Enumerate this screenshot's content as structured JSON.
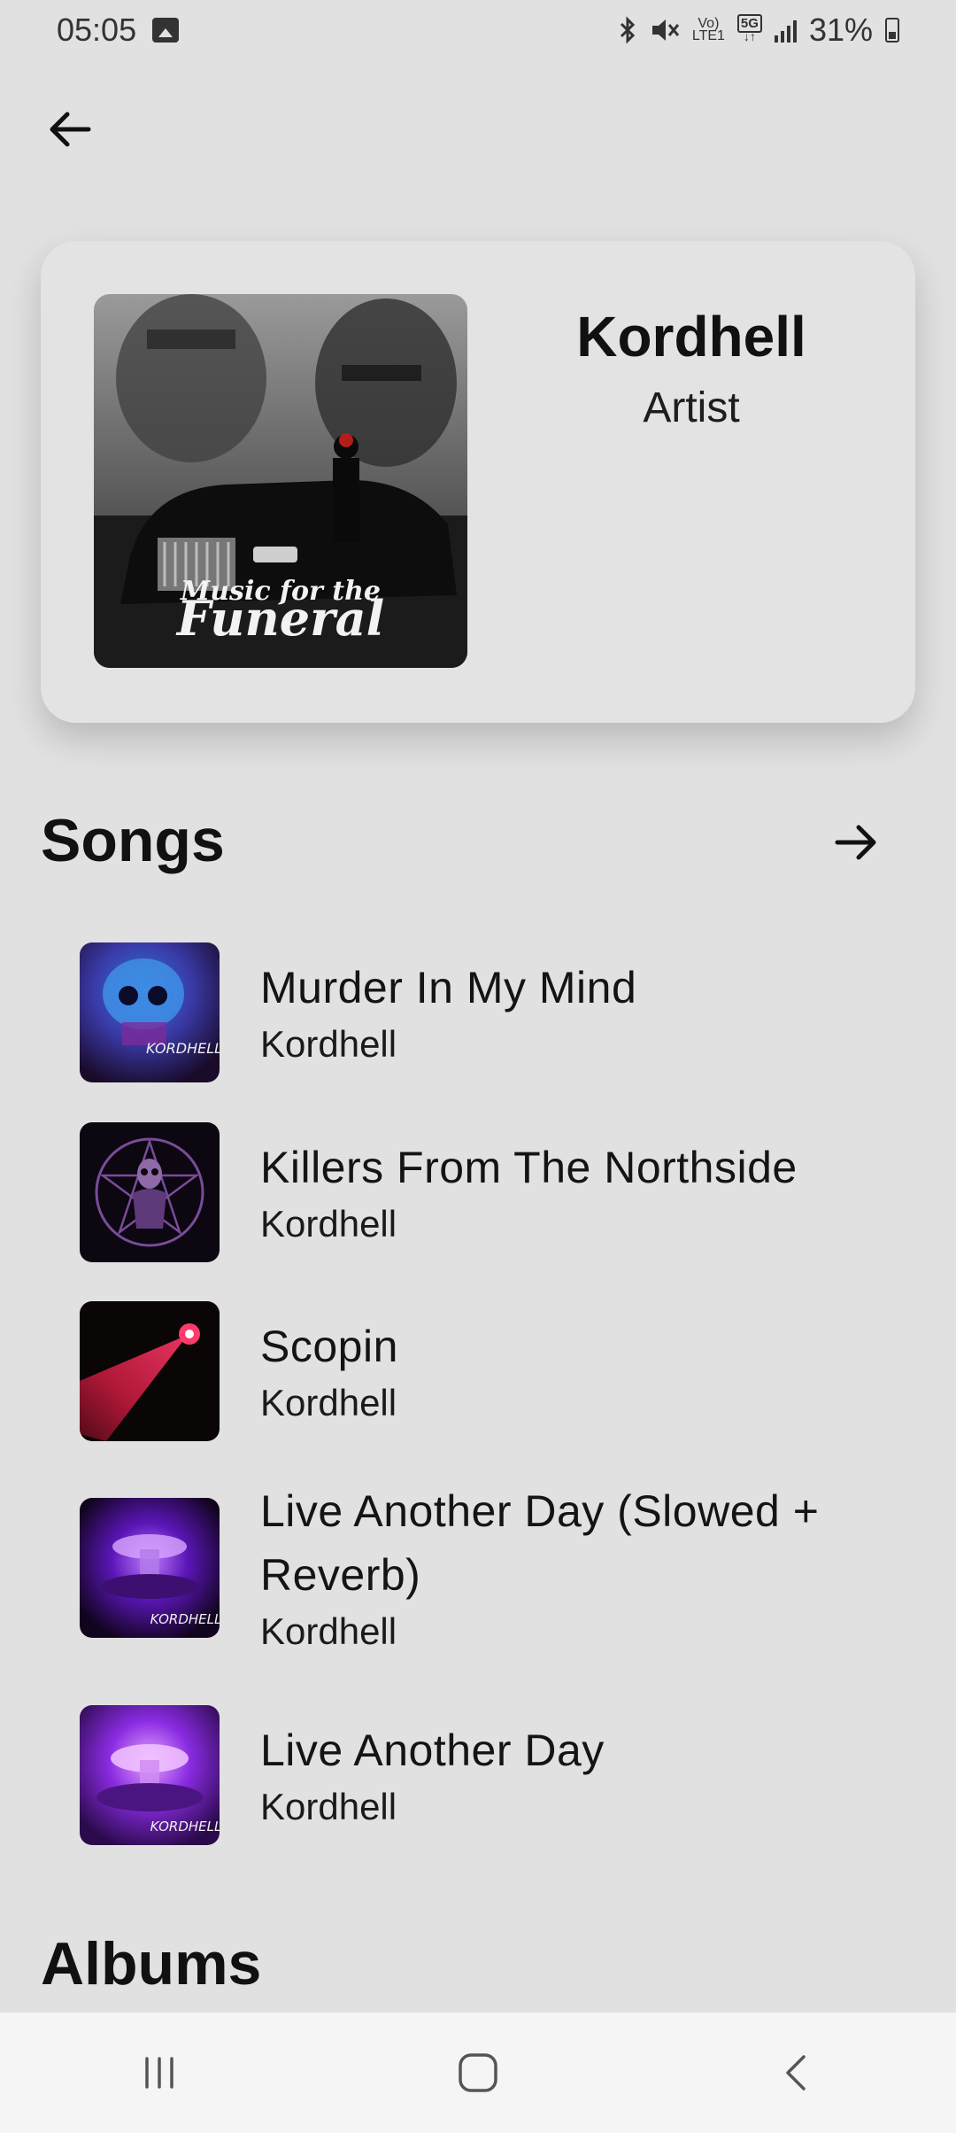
{
  "status_bar": {
    "time": "05:05",
    "network": "5G",
    "volte": "Vo)",
    "lte": "LTE1",
    "battery": "31%"
  },
  "artist": {
    "name": "Kordhell",
    "role": "Artist",
    "cover_text": "Music for the Funeral"
  },
  "sections": {
    "songs_title": "Songs",
    "albums_title": "Albums"
  },
  "songs": [
    {
      "title": "Murder In My Mind",
      "artist": "Kordhell",
      "art_label": "KORDHELL"
    },
    {
      "title": "Killers From The Northside",
      "artist": "Kordhell"
    },
    {
      "title": "Scopin",
      "artist": "Kordhell"
    },
    {
      "title": "Live Another Day (Slowed + Reverb)",
      "artist": "Kordhell",
      "art_label": "KORDHELL"
    },
    {
      "title": "Live Another Day",
      "artist": "Kordhell",
      "art_label": "KORDHELL"
    }
  ],
  "icons": {
    "back": "arrow-left-icon",
    "more": "arrow-right-icon",
    "nav_recents": "recents-icon",
    "nav_home": "home-icon",
    "nav_back": "back-chevron-icon"
  }
}
